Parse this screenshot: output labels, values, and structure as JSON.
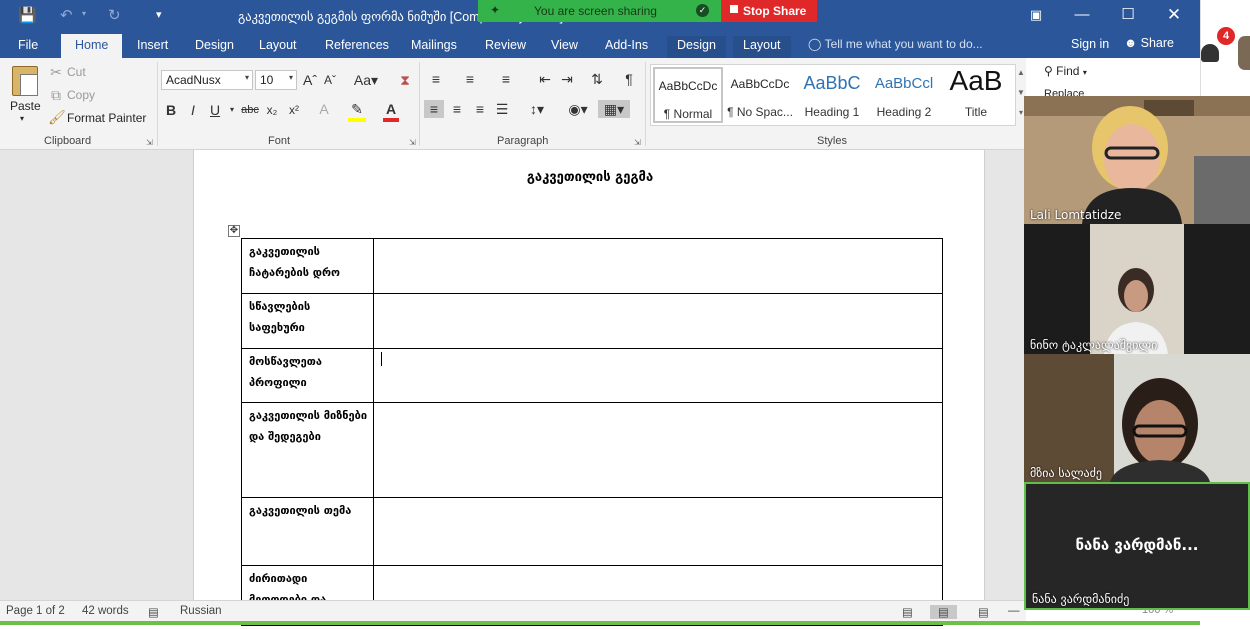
{
  "window": {
    "title": "გაკვეთილის გეგმის ფორმა ნიმუში [Compatibility Mode] - Word"
  },
  "screen_share": {
    "banner_text": "You are screen sharing",
    "stop_label": "Stop Share"
  },
  "colors": {
    "word_blue": "#2b579a",
    "share_green": "#34b34a",
    "stop_red": "#e02828"
  },
  "tabs": {
    "file": "File",
    "home": "Home",
    "insert": "Insert",
    "design": "Design",
    "layout": "Layout",
    "references": "References",
    "mailings": "Mailings",
    "review": "Review",
    "view": "View",
    "addins": "Add-Ins",
    "table_design": "Design",
    "table_layout": "Layout"
  },
  "tell_me": "Tell me what you want to do...",
  "signin": "Sign in",
  "share": "Share",
  "clipboard": {
    "paste": "Paste",
    "cut": "Cut",
    "copy": "Copy",
    "format_painter": "Format Painter",
    "label": "Clipboard"
  },
  "font": {
    "name": "AcadNusx",
    "size": "10",
    "label": "Font"
  },
  "paragraph": {
    "label": "Paragraph"
  },
  "styles": {
    "label": "Styles",
    "items": [
      {
        "sample": "AaBbCcDc",
        "name": "¶ Normal"
      },
      {
        "sample": "AaBbCcDc",
        "name": "¶ No Spac..."
      },
      {
        "sample": "AaBbC",
        "name": "Heading 1"
      },
      {
        "sample": "AaBbCcl",
        "name": "Heading 2"
      },
      {
        "sample": "AaB",
        "name": "Title"
      }
    ]
  },
  "editing": {
    "find": "Find",
    "replace": "Replace"
  },
  "document": {
    "title": "გაკვეთილის გეგმა",
    "rows": [
      {
        "label": "გაკვეთილის ჩატარების დრო"
      },
      {
        "label": "სწავლების საფეხური"
      },
      {
        "label": "მოსწავლეთა პროფილი"
      },
      {
        "label": "გაკვეთილის მიზნები და შედეგები"
      },
      {
        "label": "გაკვეთილის თემა"
      },
      {
        "label": "ძირითადი მეთოდები და"
      }
    ]
  },
  "status": {
    "page": "Page 1 of 2",
    "words": "42 words",
    "language": "Russian",
    "zoom": "100 %"
  },
  "notifications": {
    "count": "4"
  },
  "participants": [
    {
      "name": "Lali Lomtatidze"
    },
    {
      "name": "ნინო ტაკლალაშვილი"
    },
    {
      "name": "მზია სალაძე"
    },
    {
      "name": "ნანა ვარდმანიძე",
      "display": "ნანა ვარდმან..."
    }
  ]
}
